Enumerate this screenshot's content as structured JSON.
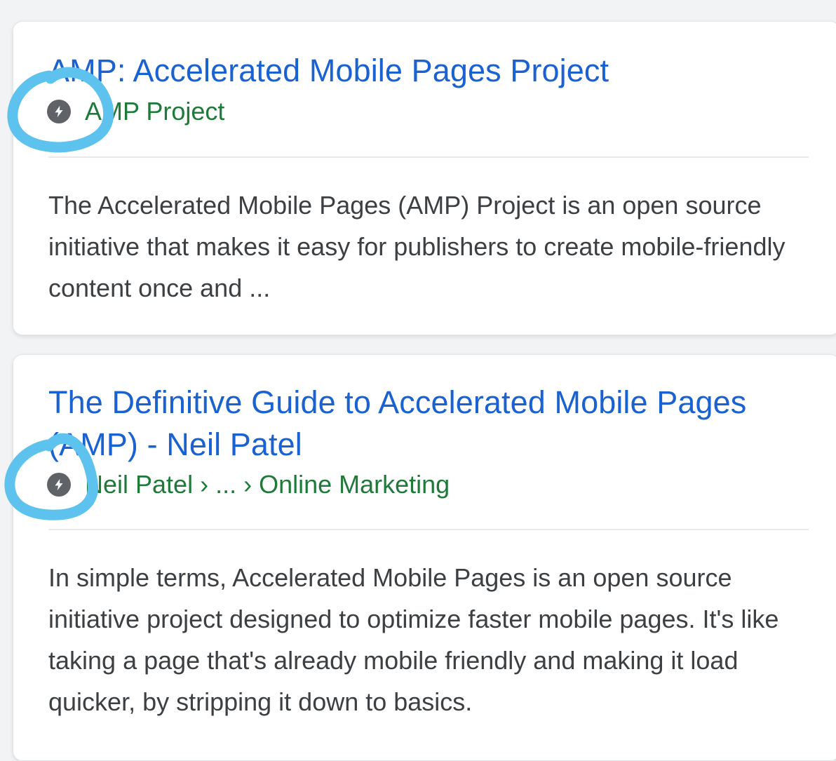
{
  "results": [
    {
      "title": "AMP: Accelerated Mobile Pages Project",
      "url_text": "AMP Project",
      "icon": "amp-bolt-icon",
      "snippet": "The Accelerated Mobile Pages (AMP) Project is an open source initiative that makes it easy for publishers to create mobile-friendly content once and ..."
    },
    {
      "title": "The Definitive Guide to Accelerated Mobile Pages (AMP) - Neil Patel",
      "url_text": "Neil Patel › ... › Online Marketing",
      "icon": "amp-bolt-icon",
      "snippet": "In simple terms, Accelerated Mobile Pages is an open source initiative project designed to optimize faster mobile pages. It's like taking a page that's already mobile friendly and making it load quicker, by stripping it down to basics."
    }
  ],
  "colors": {
    "title_link": "#1a61d1",
    "url_green": "#1f7a3a",
    "snippet_text": "#3c4043",
    "amp_icon_bg": "#5f6368",
    "highlight_annotation": "#5ec2ee"
  }
}
